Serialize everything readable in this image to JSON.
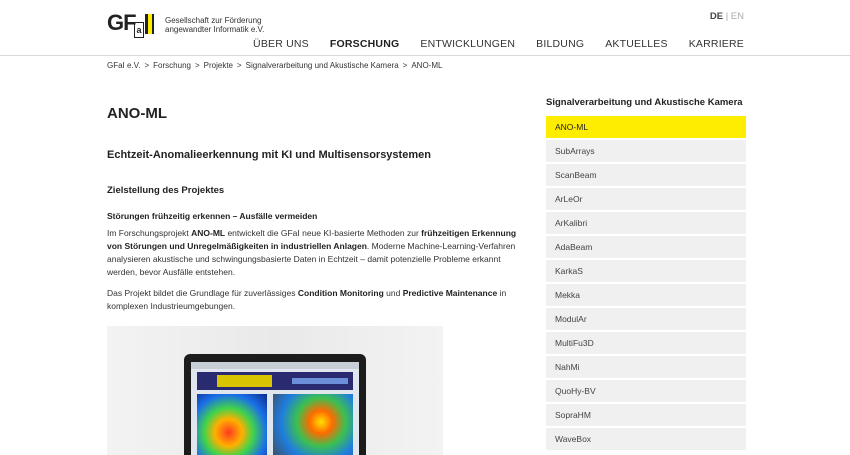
{
  "header": {
    "logo_text_line1": "Gesellschaft zur Förderung",
    "logo_text_line2": "angewandter Informatik e.V.",
    "logo_mark": "GFaI",
    "lang_active": "DE",
    "lang_sep": "|",
    "lang_other": "EN",
    "nav": [
      {
        "label": "ÜBER UNS"
      },
      {
        "label": "FORSCHUNG"
      },
      {
        "label": "ENTWICKLUNGEN"
      },
      {
        "label": "BILDUNG"
      },
      {
        "label": "AKTUELLES"
      },
      {
        "label": "KARRIERE"
      }
    ]
  },
  "breadcrumb": {
    "items": [
      "GFaI e.V.",
      "Forschung",
      "Projekte",
      "Signalverarbeitung und Akustische Kamera",
      "ANO-ML"
    ],
    "separator": ">"
  },
  "main": {
    "title": "ANO-ML",
    "subtitle": "Echtzeit-Anomalieerkennung mit KI und Multisensorsystemen",
    "section_heading": "Zielstellung des Projektes",
    "sub_heading": "Störungen frühzeitig erkennen – Ausfälle vermeiden",
    "p1_a": "Im Forschungsprojekt ",
    "p1_b": "ANO-ML",
    "p1_c": " entwickelt die GFaI neue KI-basierte Methoden zur ",
    "p1_d": "frühzeitigen Erkennung von Störungen und Unregelmäßigkeiten in industriellen Anlagen",
    "p1_e": ". Moderne Machine-Learning-Verfahren analysieren akustische und schwingungsbasierte Daten in Echtzeit – damit potenzielle Probleme erkannt werden, bevor Ausfälle entstehen.",
    "p2_a": "Das Projekt bildet die Grundlage für zuverlässiges ",
    "p2_b": "Condition Monitoring",
    "p2_c": " und ",
    "p2_d": "Predictive Maintenance",
    "p2_e": " in komplexen Industrieumgebungen."
  },
  "sidebar": {
    "title": "Signalverarbeitung und Akustische Kamera",
    "items": [
      {
        "label": "ANO-ML"
      },
      {
        "label": "SubArrays"
      },
      {
        "label": "ScanBeam"
      },
      {
        "label": "ArLeOr"
      },
      {
        "label": "ArKalibri"
      },
      {
        "label": "AdaBeam"
      },
      {
        "label": "KarkaS"
      },
      {
        "label": "Mekka"
      },
      {
        "label": "ModulAr"
      },
      {
        "label": "MultiFu3D"
      },
      {
        "label": "NahMi"
      },
      {
        "label": "QuoHy-BV"
      },
      {
        "label": "SopraHM"
      },
      {
        "label": "WaveBox"
      }
    ]
  },
  "colors": {
    "accent": "#ffed00",
    "sidebar_bg": "#f0f0f0",
    "text": "#222222"
  }
}
